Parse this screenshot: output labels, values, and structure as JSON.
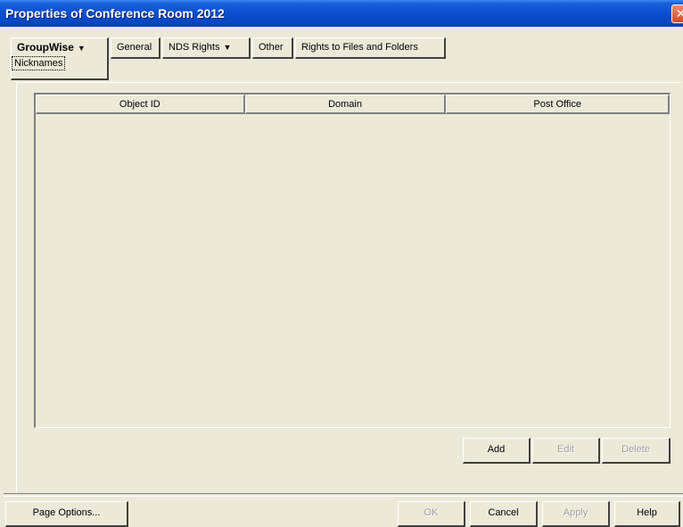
{
  "window": {
    "title": "Properties of Conference Room 2012"
  },
  "tabs": [
    {
      "label": "GroupWise",
      "has_menu": true,
      "active": true,
      "subtab": "Nicknames"
    },
    {
      "label": "General",
      "has_menu": false
    },
    {
      "label": "NDS Rights",
      "has_menu": true
    },
    {
      "label": "Other",
      "has_menu": false
    },
    {
      "label": "Rights to Files and Folders",
      "has_menu": false
    }
  ],
  "grid": {
    "columns": [
      "Object ID",
      "Domain",
      "Post Office"
    ],
    "rows": []
  },
  "list_buttons": {
    "add": "Add",
    "edit": "Edit",
    "delete": "Delete"
  },
  "footer": {
    "page_options": "Page Options...",
    "ok": "OK",
    "cancel": "Cancel",
    "apply": "Apply",
    "help": "Help"
  },
  "icons": {
    "close": "close-icon",
    "dropdown": "chevron-down-icon"
  }
}
